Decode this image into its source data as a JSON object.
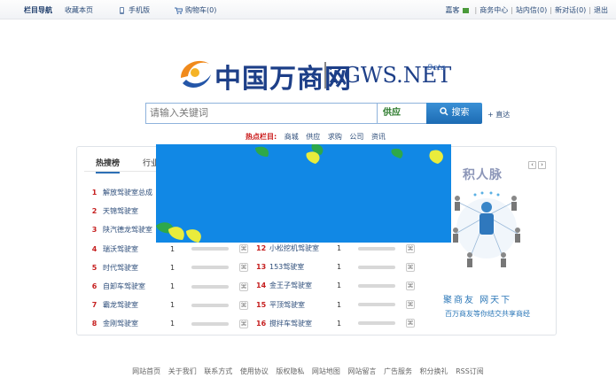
{
  "topbar": {
    "brand": "栏目导航",
    "bookmark": "收藏本页",
    "mobile": "手机版",
    "cart": "购物车(0)",
    "guest": "嘉客",
    "business": "商务中心",
    "inbox": "站内信(0)",
    "new_chat": "新对话(0)",
    "logout": "退出"
  },
  "logo": {
    "cn": "中国万商网",
    "en": "ZGWS.NET",
    "beta": "Beta"
  },
  "search": {
    "placeholder": "请输入关键词",
    "category": "供应",
    "button": "搜索",
    "direct": "直达"
  },
  "hot": {
    "label": "热点栏目:",
    "items": [
      "商城",
      "供应",
      "求购",
      "公司",
      "资讯"
    ]
  },
  "tabs": [
    {
      "label": "热搜榜",
      "active": true
    },
    {
      "label": "行业"
    }
  ],
  "ranking_left": [
    {
      "num": "1",
      "name": "解放驾驶室总成",
      "count": "",
      "link": ""
    },
    {
      "num": "2",
      "name": "天锦驾驶室",
      "count": "",
      "link": ""
    },
    {
      "num": "3",
      "name": "陕汽德龙驾驶室",
      "count": "",
      "link": ""
    },
    {
      "num": "4",
      "name": "瑞沃驾驶室",
      "count": "1",
      "link": "⌘"
    },
    {
      "num": "5",
      "name": "时代驾驶室",
      "count": "1",
      "link": "⌘"
    },
    {
      "num": "6",
      "name": "自卸车驾驶室",
      "count": "1",
      "link": "⌘"
    },
    {
      "num": "7",
      "name": "霸龙驾驶室",
      "count": "1",
      "link": "⌘"
    },
    {
      "num": "8",
      "name": "金刚驾驶室",
      "count": "1",
      "link": "⌘"
    }
  ],
  "ranking_right": [
    {
      "num": "12",
      "name": "小松挖机驾驶室",
      "count": "1",
      "link": "⌘"
    },
    {
      "num": "13",
      "name": "153驾驶室",
      "count": "1",
      "link": "⌘"
    },
    {
      "num": "14",
      "name": "金王子驾驶室",
      "count": "1",
      "link": "⌘"
    },
    {
      "num": "15",
      "name": "平顶驾驶室",
      "count": "1",
      "link": "⌘"
    },
    {
      "num": "16",
      "name": "搅拌车驾驶室",
      "count": "1",
      "link": "⌘"
    }
  ],
  "side": {
    "title": "积人脉",
    "slogan": "聚商友 网天下",
    "sub": "百万商友等你结交共享商经",
    "prev": "‹",
    "next": "›"
  },
  "footer": [
    "网站首页",
    "关于我们",
    "联系方式",
    "使用协议",
    "版权隐私",
    "网站地图",
    "网站留言",
    "广告服务",
    "积分换礼",
    "RSS订阅"
  ]
}
